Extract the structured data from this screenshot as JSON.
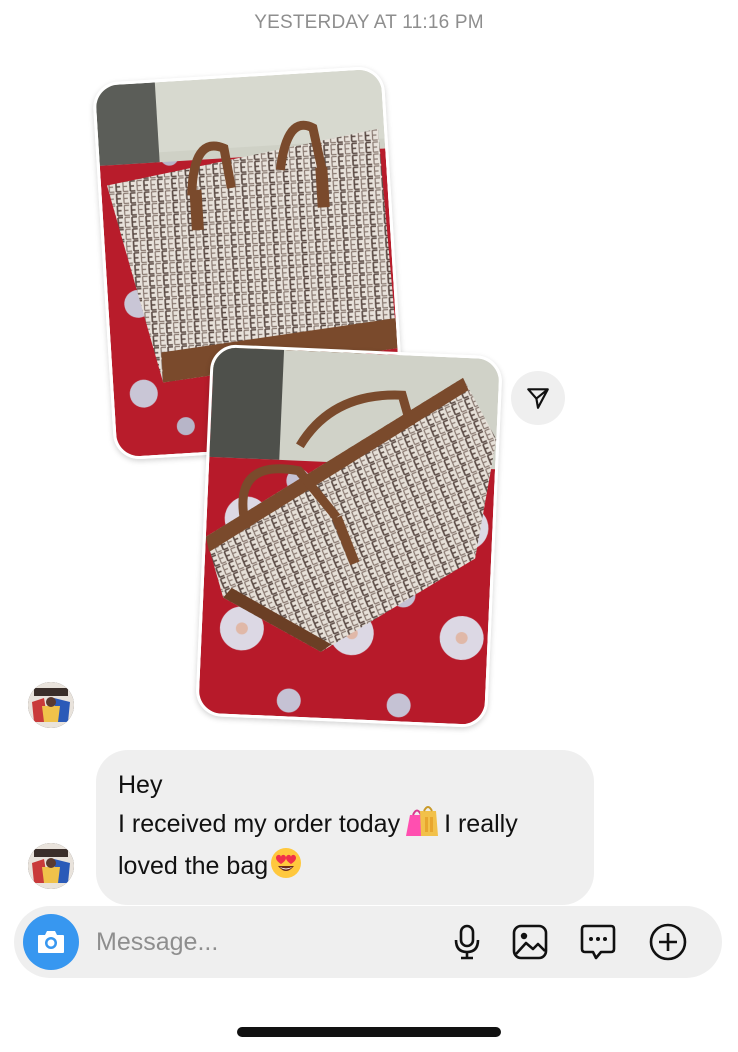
{
  "thread": {
    "timestamp": "YESTERDAY AT 11:16 PM"
  },
  "media": {
    "photos": [
      {
        "subject": "tote bag with monogram pattern, upright on red floral cloth"
      },
      {
        "subject": "tote bag with monogram pattern, tilted on red floral cloth"
      }
    ],
    "share_icon": "paper-plane-icon"
  },
  "message": {
    "line1": "Hey",
    "line2_a": "I received my order today",
    "line2_emoji": "shopping-bags-emoji",
    "line2_b": "I really",
    "line3_a": "loved the bag",
    "line3_emoji": "heart-eyes-emoji"
  },
  "composer": {
    "placeholder": "Message...",
    "value": "",
    "icons": [
      "camera-icon",
      "microphone-icon",
      "gallery-icon",
      "sticker-icon",
      "plus-icon"
    ]
  },
  "colors": {
    "bubble_bg": "#efefef",
    "camera_button": "#3797f0",
    "timestamp_text": "#8e8e8e"
  }
}
